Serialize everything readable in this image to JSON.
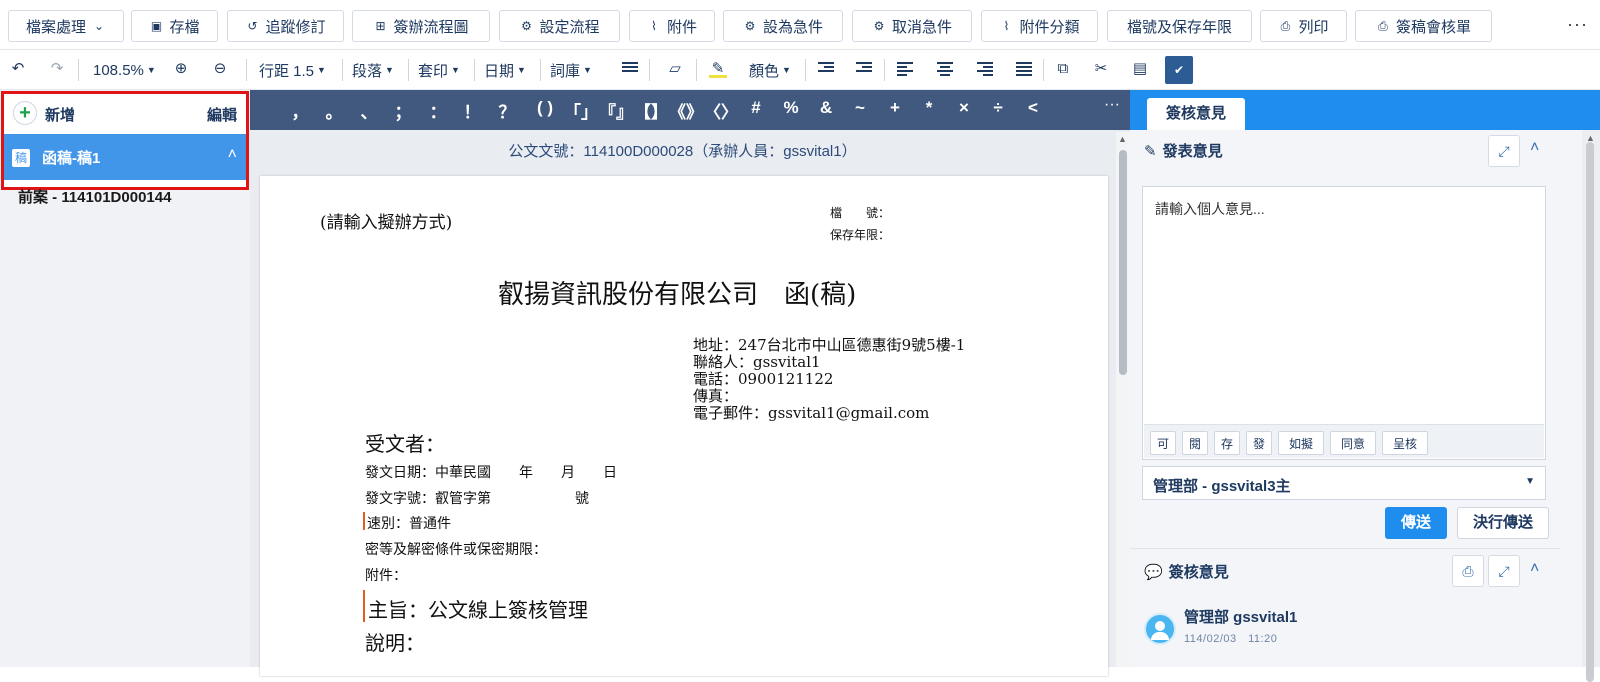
{
  "toolbar1": {
    "file_menu": "檔案處理",
    "save": "存檔",
    "track_changes": "追蹤修訂",
    "flowchart": "簽辦流程圖",
    "set_flow": "設定流程",
    "attachment": "附件",
    "set_urgent": "設為急件",
    "cancel_urgent": "取消急件",
    "attachment_category": "附件分纇",
    "file_number_retention": "檔號及保存年限",
    "print": "列印",
    "print_sign_sheet": "簽稿會核單",
    "more": "···"
  },
  "toolbar2": {
    "zoom": "108.5%",
    "line_spacing": "行距 1.5",
    "paragraph": "段落",
    "template_print": "套印",
    "date": "日期",
    "phrase_library": "詞庫",
    "color": "顏色"
  },
  "left_panel": {
    "new_label": "新增",
    "edit_label": "編輯",
    "selected_icon_text": "稿",
    "selected_item": "函稿-稿1",
    "previous_case": "前案 - 114101D000144"
  },
  "punctuation": [
    "，",
    "。",
    "、",
    "；",
    "：",
    "！",
    "？",
    "( )",
    "「」",
    "『』",
    "【】",
    "《》",
    "〈〉",
    "#",
    "%",
    "&",
    "~",
    "+",
    "*",
    "×",
    "÷",
    "<"
  ],
  "document": {
    "header_line": "公文文號：114100D000028（承辦人員：gssvital1）",
    "method_placeholder": "(請輸入擬辦方式)",
    "file_no_label": "檔　　號：",
    "retention_label": "保存年限：",
    "title": "叡揚資訊股份有限公司　函(稿)",
    "address": "地址：247台北市中山區德惠街9號5樓-1",
    "contact": "聯絡人：gssvital1",
    "phone": "電話：0900121122",
    "fax": "傳真：",
    "email": "電子郵件：gssvital1@gmail.com",
    "recipient": "受文者：",
    "issue_date": "發文日期：中華民國　　年　　月　　日",
    "issue_no": "發文字號：叡管字第　　　　　　號",
    "speed": "速別：普通件",
    "secrecy": "密等及解密條件或保密期限：",
    "attachments": "附件：",
    "subject": "主旨：公文線上簽核管理",
    "explanation": "說明："
  },
  "right_panel": {
    "tab": "簽核意見",
    "post_opinion": "發表意見",
    "textarea_placeholder": "請輸入個人意見...",
    "quick_buttons": [
      "可",
      "閱",
      "存",
      "發",
      "如擬",
      "同意",
      "呈核"
    ],
    "recipient_select": "管理部 - gssvital3主",
    "send": "傳送",
    "decide_send": "決行傳送",
    "opinions_title": "簽核意見",
    "comment_author": "管理部 gssvital1",
    "comment_time": "114/02/03　11:20"
  },
  "colors": {
    "accent_blue": "#1f8ded",
    "punct_bar": "#41597e",
    "selected_row": "#4196ea",
    "highlight_border": "#e01414"
  }
}
